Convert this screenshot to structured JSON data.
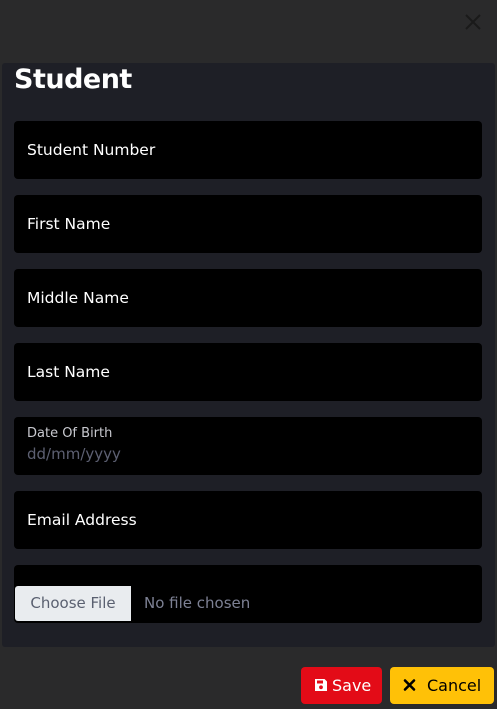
{
  "modal": {
    "title": "Student",
    "close_icon": "close-icon"
  },
  "fields": {
    "student_number": "Student Number",
    "first_name": "First Name",
    "middle_name": "Middle Name",
    "last_name": "Last Name",
    "date_of_birth_label": "Date Of Birth",
    "date_of_birth_placeholder": "dd/mm/yyyy",
    "email_address": "Email Address",
    "file_button": "Choose File",
    "file_status": "No file chosen"
  },
  "actions": {
    "save_label": "Save",
    "save_icon": "floppy-disk-icon",
    "cancel_label": "Cancel",
    "cancel_icon": "x-icon"
  },
  "colors": {
    "save_bg": "#e30b17",
    "cancel_bg": "#ffc107",
    "panel_bg": "#1e1f26",
    "field_bg": "#000000"
  }
}
